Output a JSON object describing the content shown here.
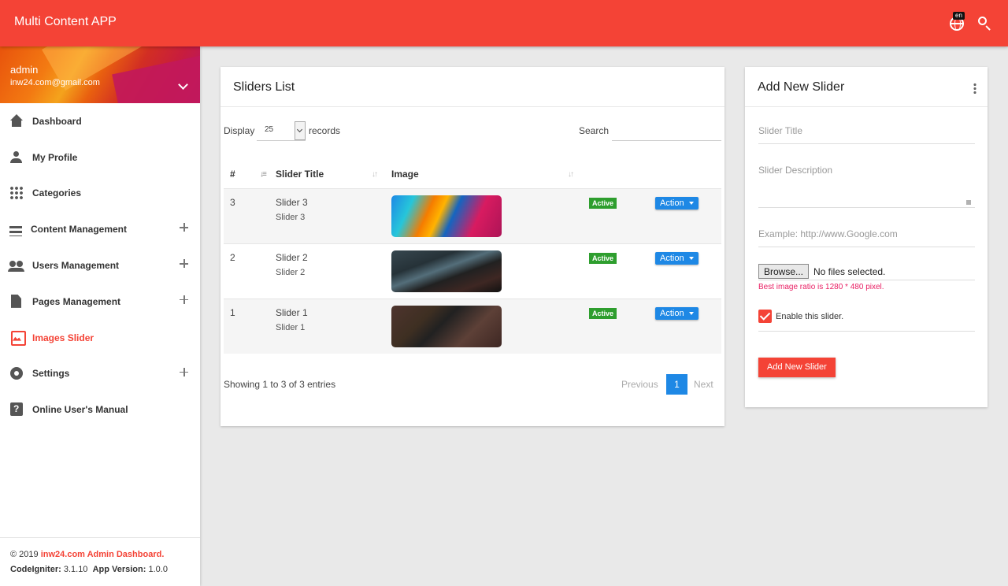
{
  "app": {
    "title": "Multi Content APP",
    "language_badge": "en"
  },
  "user": {
    "name": "admin",
    "email": "inw24.com@gmail.com"
  },
  "sidebar": {
    "items": [
      {
        "label": "Dashboard",
        "icon": "home-icon",
        "expandable": false,
        "active": false
      },
      {
        "label": "My Profile",
        "icon": "person-icon",
        "expandable": false,
        "active": false
      },
      {
        "label": "Categories",
        "icon": "grid-icon",
        "expandable": false,
        "active": false
      },
      {
        "label": "Content Management",
        "icon": "list-icon",
        "expandable": true,
        "active": false
      },
      {
        "label": "Users Management",
        "icon": "people-icon",
        "expandable": true,
        "active": false
      },
      {
        "label": "Pages Management",
        "icon": "page-icon",
        "expandable": true,
        "active": false
      },
      {
        "label": "Images Slider",
        "icon": "image-icon",
        "expandable": false,
        "active": true
      },
      {
        "label": "Settings",
        "icon": "gear-icon",
        "expandable": true,
        "active": false
      },
      {
        "label": "Online User's Manual",
        "icon": "help-icon",
        "expandable": false,
        "active": false
      }
    ]
  },
  "footer": {
    "copyright": "© 2019",
    "brand": "inw24.com Admin Dashboard.",
    "codeigniter_label": "CodeIgniter:",
    "codeigniter_version": "3.1.10",
    "app_version_label": "App Version:",
    "app_version": "1.0.0"
  },
  "sliders_list": {
    "title": "Sliders List",
    "display_label": "Display",
    "display_value": "25",
    "records_label": "records",
    "search_label": "Search",
    "search_value": "",
    "columns": [
      "#",
      "Slider Title",
      "Image"
    ],
    "rows": [
      {
        "id": "3",
        "title": "Slider 3",
        "subtitle": "Slider 3",
        "status": "Active",
        "action": "Action"
      },
      {
        "id": "2",
        "title": "Slider 2",
        "subtitle": "Slider 2",
        "status": "Active",
        "action": "Action"
      },
      {
        "id": "1",
        "title": "Slider 1",
        "subtitle": "Slider 1",
        "status": "Active",
        "action": "Action"
      }
    ],
    "showing": "Showing 1 to 3 of 3 entries",
    "pagination": {
      "previous": "Previous",
      "current": "1",
      "next": "Next"
    }
  },
  "add_slider": {
    "title": "Add New Slider",
    "title_placeholder": "Slider Title",
    "description_placeholder": "Slider Description",
    "url_placeholder": "Example: http://www.Google.com",
    "browse_label": "Browse...",
    "no_file": "No files selected.",
    "hint": "Best image ratio is 1280 * 480 pixel.",
    "enable_label": "Enable this slider.",
    "enabled": true,
    "submit": "Add New Slider"
  },
  "colors": {
    "primary": "#f44336",
    "accent": "#1e88e5",
    "active_badge": "#2e9e2e"
  }
}
